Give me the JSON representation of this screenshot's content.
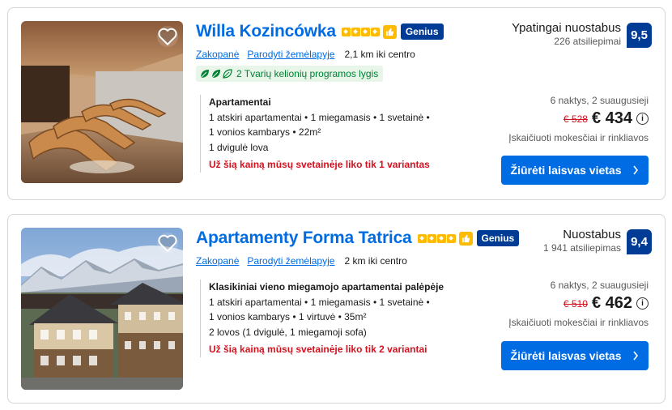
{
  "listings": [
    {
      "name": "Willa Kozincówka",
      "stars": 4,
      "genius_label": "Genius",
      "location": "Zakopanė",
      "map_link": "Parodyti žemėlapyje",
      "distance": "2,1 km iki centro",
      "eco_label": "2 Tvarių kelionių programos lygis",
      "room_type": "Apartamentai",
      "features": [
        "1 atskiri apartamentai • 1 miegamasis • 1 svetainė •",
        "1 vonios kambarys • 22m²",
        "1 dvigulė lova"
      ],
      "warning": "Už šią kainą mūsų svetainėje liko tik 1 variantas",
      "rating_word": "Ypatingai nuostabus",
      "reviews": "226 atsiliepimai",
      "score": "9,5",
      "stay": "6 naktys, 2 suaugusieji",
      "old_price": "€ 528",
      "price": "€ 434",
      "taxes": "Įskaičiuoti mokesčiai ir rinkliavos",
      "cta": "Žiūrėti laisvas vietas"
    },
    {
      "name": "Apartamenty Forma Tatrica",
      "stars": 4,
      "genius_label": "Genius",
      "location": "Zakopanė",
      "map_link": "Parodyti žemėlapyje",
      "distance": "2 km iki centro",
      "room_type": "Klasikiniai vieno miegamojo apartamentai palėpėje",
      "features": [
        "1 atskiri apartamentai • 1 miegamasis • 1 svetainė •",
        "1 vonios kambarys • 1 virtuvė • 35m²",
        "2 lovos (1 dvigulė, 1 miegamoji sofa)"
      ],
      "warning": "Už šią kainą mūsų svetainėje liko tik 2 variantai",
      "rating_word": "Nuostabus",
      "reviews": "1 941 atsiliepimas",
      "score": "9,4",
      "stay": "6 naktys, 2 suaugusieji",
      "old_price": "€ 510",
      "price": "€ 462",
      "taxes": "Įskaičiuoti mokesčiai ir rinkliavos",
      "cta": "Žiūrėti laisvas vietas"
    }
  ],
  "icons": {
    "favorite": "heart-outline-icon",
    "stars": "star-icon",
    "preferred": "thumbs-up-icon",
    "eco": "leaf-icon",
    "info": "info-circle-icon",
    "cta_arrow": "chevron-right-icon"
  },
  "colors": {
    "link": "#006ce4",
    "brand_dark": "#003b95",
    "star": "#febb02",
    "warning": "#d4111e",
    "eco_green": "#008234",
    "cta": "#006ce4"
  }
}
